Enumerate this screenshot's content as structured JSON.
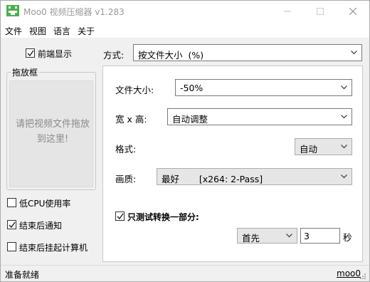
{
  "window": {
    "title": "Moo0 视频压缩器 v1.283"
  },
  "menu": [
    "文件",
    "视图",
    "语言",
    "关于"
  ],
  "left": {
    "always_on_top": {
      "label": "前端显示",
      "checked": true
    },
    "drop_box": {
      "caption": "拖放框",
      "hint": "请把视频文件拖放到这里!"
    },
    "low_cpu": {
      "label": "低CPU使用率",
      "checked": false
    },
    "notify_when_done": {
      "label": "结束后通知",
      "checked": true
    },
    "hibernate_when_done": {
      "label": "结束后挂起计算机",
      "checked": false
    }
  },
  "method": {
    "label": "方式:",
    "value": "按文件大小  (%)"
  },
  "settings": {
    "file_size": {
      "label": "文件大小:",
      "value": "-50%"
    },
    "dimensions": {
      "label": "宽 x 高:",
      "value": "自动调整"
    },
    "format": {
      "label": "格式:",
      "value": "自动"
    },
    "quality": {
      "label": "画质:",
      "value": "最好       [x264: 2-Pass]"
    },
    "test_part": {
      "label": "只测试转换一部分:",
      "checked": true
    },
    "test_position": {
      "value": "首先"
    },
    "test_seconds": {
      "value": "3",
      "unit": "秒"
    }
  },
  "status": {
    "text": "准备就绪",
    "link": "moo0"
  },
  "colors": {
    "window_bg": "#f0f0f0",
    "panel_bg": "#ffffff",
    "title_text": "#999999",
    "hint_text": "#8a8a8a",
    "icon_green": "#4caf50"
  }
}
